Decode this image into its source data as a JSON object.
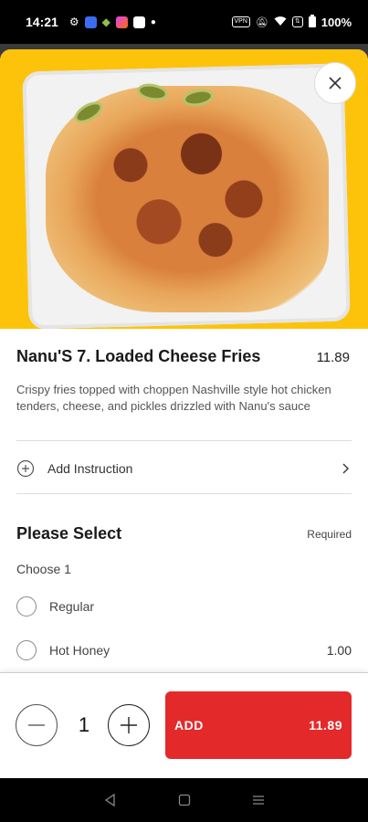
{
  "status": {
    "time": "14:21",
    "battery": "100%",
    "left_icons": [
      "gear-icon",
      "app-icon",
      "android-icon",
      "app-icon-2",
      "app-icon-3",
      "dot-icon"
    ],
    "right_icons": [
      "vpn-icon",
      "mute-icon",
      "wifi-icon",
      "data-icon",
      "battery-icon"
    ]
  },
  "item": {
    "title": "Nanu'S 7. Loaded Cheese Fries",
    "price": "11.89",
    "description": "Crispy fries topped with choppen Nashville style hot chicken tenders, cheese, and pickles drizzled with Nanu's sauce"
  },
  "instruction": {
    "label": "Add Instruction"
  },
  "selection": {
    "title": "Please Select",
    "required_label": "Required",
    "subtitle": "Choose 1",
    "options": [
      {
        "label": "Regular",
        "price": ""
      },
      {
        "label": "Hot Honey",
        "price": "1.00"
      }
    ]
  },
  "footer": {
    "quantity": "1",
    "add_label": "ADD",
    "add_price": "11.89"
  },
  "colors": {
    "hero_bg": "#FDC30A",
    "add_button": "#E4292B"
  }
}
